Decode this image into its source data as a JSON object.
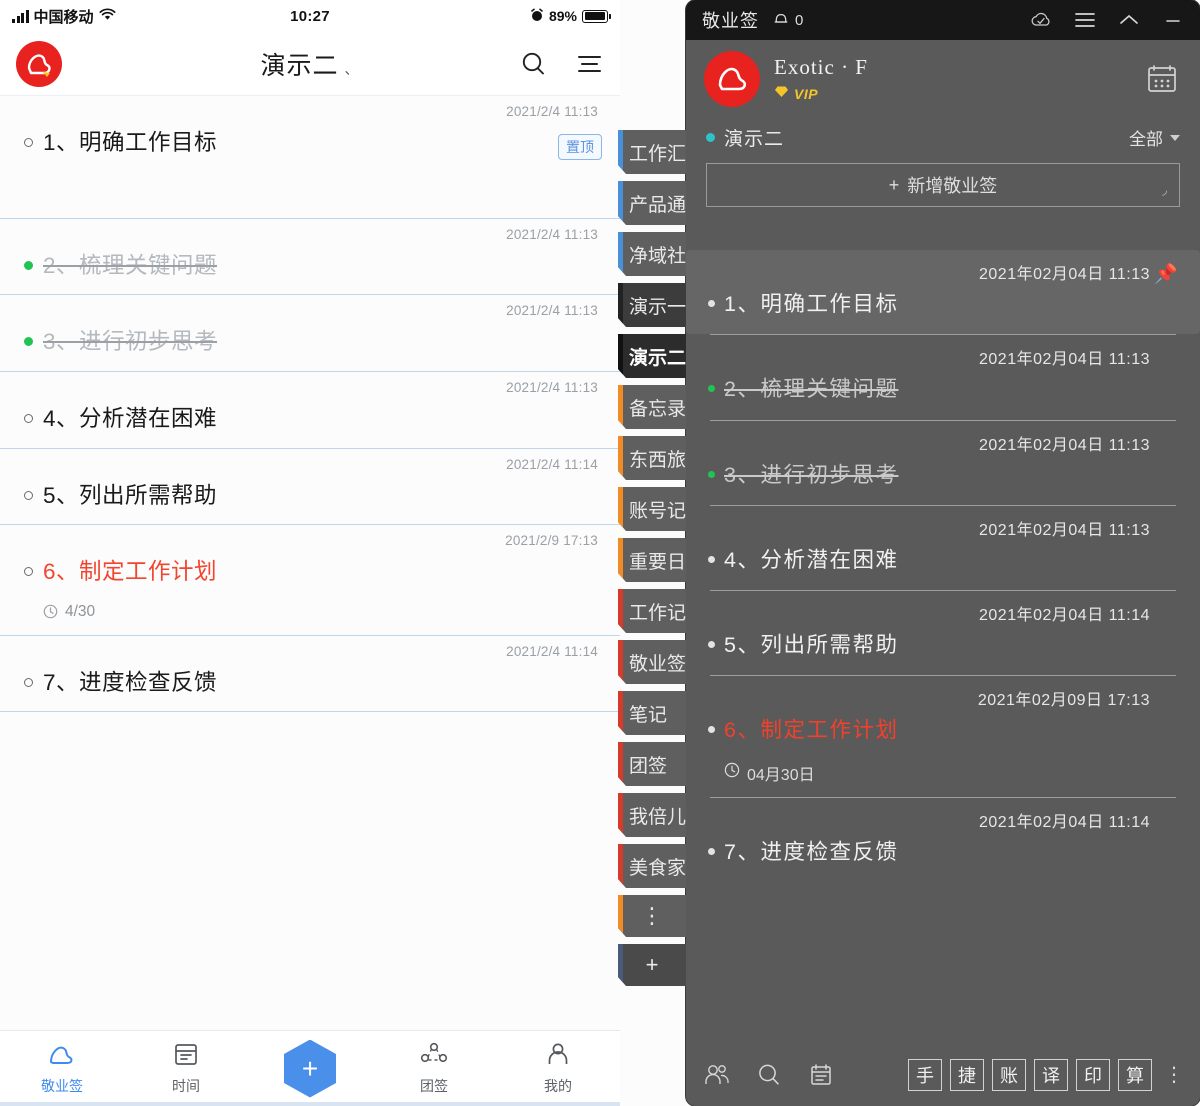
{
  "mobile": {
    "status_bar": {
      "carrier": "中国移动",
      "time": "10:27",
      "battery_percent": "89%",
      "wifi_icon": "wifi-icon",
      "signal_icon": "signal-bars-icon",
      "alarm_icon": "alarm-icon"
    },
    "appbar": {
      "title": "演示二",
      "title_suffix": "、",
      "search_icon": "search-icon",
      "menu_icon": "menu-icon",
      "logo_icon": "jingyeqian-logo-icon"
    },
    "pin_badge": "置顶",
    "notes": [
      {
        "stamp": "2021/2/4 11:13",
        "text": "1、明确工作目标",
        "state": "normal",
        "pinned": true
      },
      {
        "stamp": "2021/2/4 11:13",
        "text": "2、梳理关键问题",
        "state": "done"
      },
      {
        "stamp": "2021/2/4 11:13",
        "text": "3、进行初步思考",
        "state": "done"
      },
      {
        "stamp": "2021/2/4 11:13",
        "text": "4、分析潜在困难",
        "state": "normal"
      },
      {
        "stamp": "2021/2/4 11:14",
        "text": "5、列出所需帮助",
        "state": "normal"
      },
      {
        "stamp": "2021/2/9 17:13",
        "text": "6、制定工作计划",
        "state": "warn",
        "reminder": "4/30"
      },
      {
        "stamp": "2021/2/4 11:14",
        "text": "7、进度检查反馈",
        "state": "normal"
      }
    ],
    "categories": [
      {
        "label": "工作汇",
        "accent": "#4a90d9",
        "active": false
      },
      {
        "label": "产品通",
        "accent": "#4a90d9",
        "active": false
      },
      {
        "label": "净域社",
        "accent": "#4a90d9",
        "active": false
      },
      {
        "label": "演示一",
        "accent": "#222222",
        "active": false,
        "dark": true
      },
      {
        "label": "演示二",
        "accent": "#111111",
        "active": true
      },
      {
        "label": "备忘录",
        "accent": "#f08b26",
        "active": false
      },
      {
        "label": "东西旅",
        "accent": "#f08b26",
        "active": false
      },
      {
        "label": "账号记",
        "accent": "#f08b26",
        "active": false
      },
      {
        "label": "重要日",
        "accent": "#f08b26",
        "active": false
      },
      {
        "label": "工作记",
        "accent": "#d43b2b",
        "active": false
      },
      {
        "label": "敬业签",
        "accent": "#d43b2b",
        "active": false
      },
      {
        "label": "笔记",
        "accent": "#d43b2b",
        "active": false
      },
      {
        "label": "团签",
        "accent": "#d43b2b",
        "active": false
      },
      {
        "label": "我倍儿",
        "accent": "#d43b2b",
        "active": false
      },
      {
        "label": "美食家",
        "accent": "#d43b2b",
        "active": false
      },
      {
        "label": "⋮",
        "accent": "#f08b26",
        "active": false,
        "mini": true
      },
      {
        "label": "+",
        "accent": "#4a5a7a",
        "active": false,
        "mini": true,
        "plus": true
      }
    ],
    "tabbar": [
      {
        "label": "敬业签",
        "icon": "jingyeqian-icon",
        "active": true
      },
      {
        "label": "时间",
        "icon": "calendar-icon",
        "active": false
      },
      {
        "label": "",
        "icon": "add-hexagon-icon",
        "active": false,
        "fab": true
      },
      {
        "label": "团签",
        "icon": "group-icon",
        "active": false
      },
      {
        "label": "我的",
        "icon": "person-icon",
        "active": false
      }
    ]
  },
  "desktop": {
    "titlebar": {
      "brand": "敬业签",
      "notification_count": "0",
      "bell_icon": "bell-icon",
      "cloud_icon": "cloud-sync-icon",
      "menu_icon": "hamburger-menu-icon",
      "collapse_icon": "chevron-up-icon",
      "minimize_icon": "minimize-icon"
    },
    "profile": {
      "username": "Exotic · F",
      "vip_label": "VIP",
      "vip_diamond_icon": "diamond-icon",
      "avatar_icon": "jingyeqian-logo-icon",
      "calendar_icon": "calendar-icon"
    },
    "category": {
      "name": "演示二",
      "filter_label": "全部",
      "dot_color": "#2fc2c9"
    },
    "add_button": {
      "label": "新增敬业签",
      "plus": "+"
    },
    "notes": [
      {
        "stamp": "2021年02月04日  11:13",
        "text": "1、明确工作目标",
        "state": "normal",
        "pinned": true
      },
      {
        "stamp": "2021年02月04日  11:13",
        "text": "2、梳理关键问题",
        "state": "done"
      },
      {
        "stamp": "2021年02月04日  11:13",
        "text": "3、进行初步思考",
        "state": "done"
      },
      {
        "stamp": "2021年02月04日  11:13",
        "text": "4、分析潜在困难",
        "state": "normal"
      },
      {
        "stamp": "2021年02月04日  11:14",
        "text": "5、列出所需帮助",
        "state": "normal"
      },
      {
        "stamp": "2021年02月09日  17:13",
        "text": "6、制定工作计划",
        "state": "warn",
        "reminder": "04月30日"
      },
      {
        "stamp": "2021年02月04日  11:14",
        "text": "7、进度检查反馈",
        "state": "normal"
      }
    ],
    "bottombar": {
      "icons": [
        {
          "name": "contacts-icon"
        },
        {
          "name": "search-icon"
        },
        {
          "name": "notebook-icon"
        }
      ],
      "squares": [
        "手",
        "捷",
        "账",
        "译",
        "印",
        "算"
      ],
      "more": "⋮"
    }
  }
}
